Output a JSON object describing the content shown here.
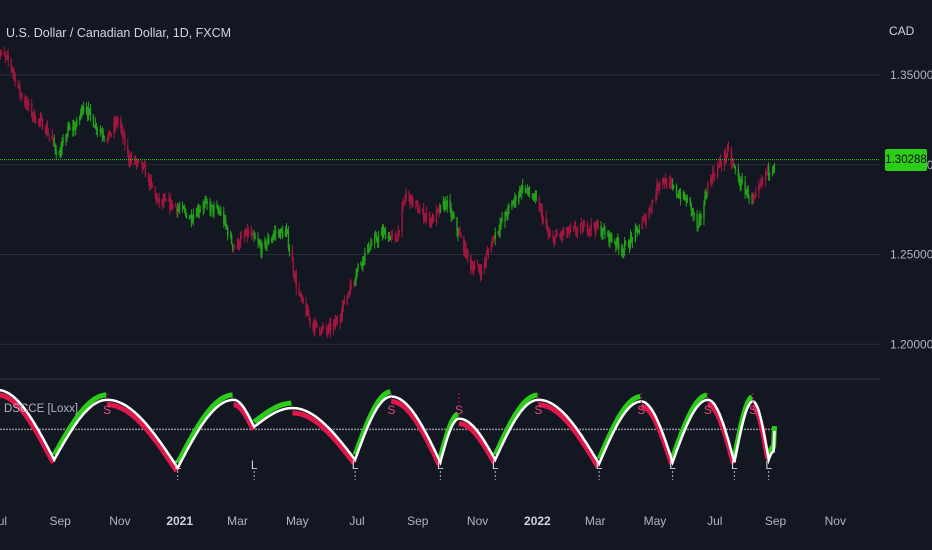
{
  "chart": {
    "title": "U.S. Dollar / Canadian Dollar, 1D, FXCM",
    "currency": "CAD",
    "last_price": "1.30288",
    "indicator_title": "DSCCE [Loxx]"
  },
  "colors": {
    "background": "#131722",
    "grid": "#2a2e39",
    "up": "#25a11b",
    "down": "#a3173f",
    "signal_green": "#2ccd19",
    "signal_red": "#e0174a",
    "main_line": "#ffffff",
    "price_line": "#2ccd19",
    "label_text": "#b2b5be"
  },
  "chart_data": [
    {
      "type": "candlestick",
      "title": "U.S. Dollar / Canadian Dollar, 1D, FXCM",
      "y_axis": {
        "label": "CAD",
        "ticks": [
          "1.35000",
          "1.30000",
          "1.25000",
          "1.20000"
        ],
        "range": [
          1.185,
          1.37
        ]
      },
      "x_axis": {
        "ticks": [
          "Jul",
          "Sep",
          "Nov",
          "2021",
          "Mar",
          "May",
          "Jul",
          "Sep",
          "Nov",
          "2022",
          "Mar",
          "May",
          "Jul",
          "Sep",
          "Nov"
        ],
        "range": [
          "2020-06-29",
          "2022-12-10"
        ]
      },
      "last_price": 1.30288,
      "close_path": [
        [
          "2020-07-01",
          1.362
        ],
        [
          "2020-07-12",
          1.357
        ],
        [
          "2020-07-22",
          1.34
        ],
        [
          "2020-08-05",
          1.327
        ],
        [
          "2020-08-17",
          1.321
        ],
        [
          "2020-08-31",
          1.305
        ],
        [
          "2020-09-09",
          1.319
        ],
        [
          "2020-09-18",
          1.322
        ],
        [
          "2020-09-25",
          1.334
        ],
        [
          "2020-10-07",
          1.322
        ],
        [
          "2020-10-20",
          1.315
        ],
        [
          "2020-10-30",
          1.325
        ],
        [
          "2020-11-10",
          1.304
        ],
        [
          "2020-11-25",
          1.298
        ],
        [
          "2020-12-10",
          1.279
        ],
        [
          "2020-12-24",
          1.278
        ],
        [
          "2021-01-12",
          1.271
        ],
        [
          "2021-01-25",
          1.278
        ],
        [
          "2021-02-12",
          1.273
        ],
        [
          "2021-02-25",
          1.254
        ],
        [
          "2021-03-12",
          1.262
        ],
        [
          "2021-03-26",
          1.253
        ],
        [
          "2021-04-08",
          1.262
        ],
        [
          "2021-04-20",
          1.262
        ],
        [
          "2021-05-02",
          1.228
        ],
        [
          "2021-05-16",
          1.211
        ],
        [
          "2021-05-31",
          1.207
        ],
        [
          "2021-06-10",
          1.212
        ],
        [
          "2021-06-22",
          1.229
        ],
        [
          "2021-07-02",
          1.243
        ],
        [
          "2021-07-14",
          1.255
        ],
        [
          "2021-07-28",
          1.262
        ],
        [
          "2021-08-10",
          1.258
        ],
        [
          "2021-08-20",
          1.284
        ],
        [
          "2021-09-01",
          1.275
        ],
        [
          "2021-09-15",
          1.269
        ],
        [
          "2021-09-30",
          1.279
        ],
        [
          "2021-10-11",
          1.264
        ],
        [
          "2021-10-25",
          1.244
        ],
        [
          "2021-11-05",
          1.241
        ],
        [
          "2021-11-18",
          1.261
        ],
        [
          "2021-12-03",
          1.275
        ],
        [
          "2021-12-17",
          1.288
        ],
        [
          "2022-01-02",
          1.278
        ],
        [
          "2022-01-14",
          1.258
        ],
        [
          "2022-01-30",
          1.262
        ],
        [
          "2022-02-12",
          1.264
        ],
        [
          "2022-02-28",
          1.266
        ],
        [
          "2022-03-15",
          1.26
        ],
        [
          "2022-03-30",
          1.253
        ],
        [
          "2022-04-12",
          1.262
        ],
        [
          "2022-04-24",
          1.273
        ],
        [
          "2022-05-07",
          1.293
        ],
        [
          "2022-05-22",
          1.285
        ],
        [
          "2022-06-05",
          1.279
        ],
        [
          "2022-06-14",
          1.264
        ],
        [
          "2022-06-25",
          1.291
        ],
        [
          "2022-07-06",
          1.3
        ],
        [
          "2022-07-14",
          1.307
        ],
        [
          "2022-07-27",
          1.29
        ],
        [
          "2022-08-10",
          1.279
        ],
        [
          "2022-08-22",
          1.295
        ],
        [
          "2022-08-29",
          1.3
        ]
      ]
    },
    {
      "type": "line",
      "title": "DSCCE [Loxx]",
      "series": [
        {
          "name": "DSCCE [Loxx]",
          "color": "#ffffff"
        }
      ],
      "cycles": [
        {
          "start": "2020-06-29",
          "peak": "2020-06-29",
          "trough": "2020-08-26",
          "trough_value": 15,
          "peak_value": 100
        },
        {
          "start": "2020-08-26",
          "peak": "2020-10-19",
          "trough": "2020-12-30",
          "trough_value": 5,
          "peak_value": 88
        },
        {
          "start": "2020-12-30",
          "peak": "2021-02-25",
          "trough": "2021-03-18",
          "trough_value": 55,
          "peak_value": 88
        },
        {
          "start": "2021-03-18",
          "peak": "2021-04-26",
          "trough": "2021-06-29",
          "trough_value": 15,
          "peak_value": 78
        },
        {
          "start": "2021-06-29",
          "peak": "2021-08-05",
          "trough": "2021-09-24",
          "trough_value": 12,
          "peak_value": 92
        },
        {
          "start": "2021-09-24",
          "peak": "2021-10-13",
          "trough": "2021-11-19",
          "trough_value": 15,
          "peak_value": 65
        },
        {
          "start": "2021-11-19",
          "peak": "2022-01-02",
          "trough": "2022-03-05",
          "trough_value": 10,
          "peak_value": 88
        },
        {
          "start": "2022-03-05",
          "peak": "2022-04-17",
          "trough": "2022-05-19",
          "trough_value": 12,
          "peak_value": 86
        },
        {
          "start": "2022-05-19",
          "peak": "2022-06-24",
          "trough": "2022-07-21",
          "trough_value": 12,
          "peak_value": 88
        },
        {
          "start": "2022-07-21",
          "peak": "2022-08-09",
          "trough": "2022-08-25",
          "trough_value": 15,
          "peak_value": 86
        },
        {
          "start": "2022-08-25",
          "peak": "2022-08-30",
          "trough": "2022-08-30",
          "trough_value": 25,
          "peak_value": 25
        }
      ],
      "level": 52,
      "y_range": [
        0,
        100
      ],
      "signals": [
        {
          "date": "2020-10-19",
          "text": "S"
        },
        {
          "date": "2020-12-30",
          "text": "L"
        },
        {
          "date": "2021-03-18",
          "text": "L"
        },
        {
          "date": "2021-06-29",
          "text": "L"
        },
        {
          "date": "2021-08-05",
          "text": "S"
        },
        {
          "date": "2021-09-24",
          "text": "L"
        },
        {
          "date": "2021-10-13",
          "text": "S"
        },
        {
          "date": "2021-11-19",
          "text": "L"
        },
        {
          "date": "2022-01-02",
          "text": "S"
        },
        {
          "date": "2022-03-05",
          "text": "L"
        },
        {
          "date": "2022-04-17",
          "text": "S"
        },
        {
          "date": "2022-05-19",
          "text": "L"
        },
        {
          "date": "2022-06-24",
          "text": "S"
        },
        {
          "date": "2022-07-21",
          "text": "L"
        },
        {
          "date": "2022-08-09",
          "text": "S"
        },
        {
          "date": "2022-08-25",
          "text": "L"
        }
      ]
    }
  ]
}
